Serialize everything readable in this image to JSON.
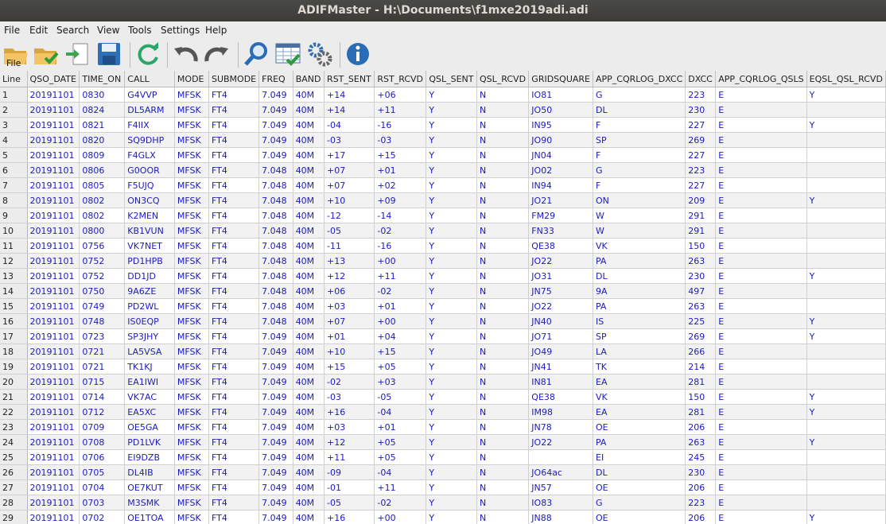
{
  "window": {
    "title": "ADIFMaster - H:\\Documents\\f1mxe2019adi.adi"
  },
  "menu": [
    "File",
    "Edit",
    "Search",
    "View",
    "Tools",
    "Settings",
    "Help"
  ],
  "toolbar": {
    "file_label": "File"
  },
  "table": {
    "columns": [
      "Line",
      "QSO_DATE",
      "TIME_ON",
      "CALL",
      "MODE",
      "SUBMODE",
      "FREQ",
      "BAND",
      "RST_SENT",
      "RST_RCVD",
      "QSL_SENT",
      "QSL_RCVD",
      "GRIDSQUARE",
      "APP_CQRLOG_DXCC",
      "DXCC",
      "APP_CQRLOG_QSLS",
      "EQSL_QSL_RCVD"
    ],
    "rows": [
      [
        "1",
        "20191101",
        "0830",
        "G4VVP",
        "MFSK",
        "FT4",
        "7.049",
        "40M",
        "+14",
        "+06",
        "Y",
        "N",
        "IO81",
        "G",
        "223",
        "E",
        "Y"
      ],
      [
        "2",
        "20191101",
        "0824",
        "DL5ARM",
        "MFSK",
        "FT4",
        "7.049",
        "40M",
        "+14",
        "+11",
        "Y",
        "N",
        "JO50",
        "DL",
        "230",
        "E",
        ""
      ],
      [
        "3",
        "20191101",
        "0821",
        "F4IIX",
        "MFSK",
        "FT4",
        "7.049",
        "40M",
        "-04",
        "-16",
        "Y",
        "N",
        "IN95",
        "F",
        "227",
        "E",
        "Y"
      ],
      [
        "4",
        "20191101",
        "0820",
        "SQ9DHP",
        "MFSK",
        "FT4",
        "7.049",
        "40M",
        "-03",
        "-03",
        "Y",
        "N",
        "JO90",
        "SP",
        "269",
        "E",
        ""
      ],
      [
        "5",
        "20191101",
        "0809",
        "F4GLX",
        "MFSK",
        "FT4",
        "7.049",
        "40M",
        "+17",
        "+15",
        "Y",
        "N",
        "JN04",
        "F",
        "227",
        "E",
        ""
      ],
      [
        "6",
        "20191101",
        "0806",
        "G0OOR",
        "MFSK",
        "FT4",
        "7.048",
        "40M",
        "+07",
        "+01",
        "Y",
        "N",
        "JO02",
        "G",
        "223",
        "E",
        ""
      ],
      [
        "7",
        "20191101",
        "0805",
        "F5UJQ",
        "MFSK",
        "FT4",
        "7.048",
        "40M",
        "+07",
        "+02",
        "Y",
        "N",
        "IN94",
        "F",
        "227",
        "E",
        ""
      ],
      [
        "8",
        "20191101",
        "0802",
        "ON3CQ",
        "MFSK",
        "FT4",
        "7.048",
        "40M",
        "+10",
        "+09",
        "Y",
        "N",
        "JO21",
        "ON",
        "209",
        "E",
        "Y"
      ],
      [
        "9",
        "20191101",
        "0802",
        "K2MEN",
        "MFSK",
        "FT4",
        "7.048",
        "40M",
        "-12",
        "-14",
        "Y",
        "N",
        "FM29",
        "W",
        "291",
        "E",
        ""
      ],
      [
        "10",
        "20191101",
        "0800",
        "KB1VUN",
        "MFSK",
        "FT4",
        "7.048",
        "40M",
        "-05",
        "-02",
        "Y",
        "N",
        "FN33",
        "W",
        "291",
        "E",
        ""
      ],
      [
        "11",
        "20191101",
        "0756",
        "VK7NET",
        "MFSK",
        "FT4",
        "7.048",
        "40M",
        "-11",
        "-16",
        "Y",
        "N",
        "QE38",
        "VK",
        "150",
        "E",
        ""
      ],
      [
        "12",
        "20191101",
        "0752",
        "PD1HPB",
        "MFSK",
        "FT4",
        "7.048",
        "40M",
        "+13",
        "+00",
        "Y",
        "N",
        "JO22",
        "PA",
        "263",
        "E",
        ""
      ],
      [
        "13",
        "20191101",
        "0752",
        "DD1JD",
        "MFSK",
        "FT4",
        "7.048",
        "40M",
        "+12",
        "+11",
        "Y",
        "N",
        "JO31",
        "DL",
        "230",
        "E",
        "Y"
      ],
      [
        "14",
        "20191101",
        "0750",
        "9A6ZE",
        "MFSK",
        "FT4",
        "7.048",
        "40M",
        "+06",
        "-02",
        "Y",
        "N",
        "JN75",
        "9A",
        "497",
        "E",
        ""
      ],
      [
        "15",
        "20191101",
        "0749",
        "PD2WL",
        "MFSK",
        "FT4",
        "7.048",
        "40M",
        "+03",
        "+01",
        "Y",
        "N",
        "JO22",
        "PA",
        "263",
        "E",
        ""
      ],
      [
        "16",
        "20191101",
        "0748",
        "IS0EQP",
        "MFSK",
        "FT4",
        "7.048",
        "40M",
        "+07",
        "+00",
        "Y",
        "N",
        "JN40",
        "IS",
        "225",
        "E",
        "Y"
      ],
      [
        "17",
        "20191101",
        "0723",
        "SP3JHY",
        "MFSK",
        "FT4",
        "7.049",
        "40M",
        "+01",
        "+04",
        "Y",
        "N",
        "JO71",
        "SP",
        "269",
        "E",
        "Y"
      ],
      [
        "18",
        "20191101",
        "0721",
        "LA5VSA",
        "MFSK",
        "FT4",
        "7.049",
        "40M",
        "+10",
        "+15",
        "Y",
        "N",
        "JO49",
        "LA",
        "266",
        "E",
        ""
      ],
      [
        "19",
        "20191101",
        "0721",
        "TK1KJ",
        "MFSK",
        "FT4",
        "7.049",
        "40M",
        "+15",
        "+05",
        "Y",
        "N",
        "JN41",
        "TK",
        "214",
        "E",
        ""
      ],
      [
        "20",
        "20191101",
        "0715",
        "EA1IWI",
        "MFSK",
        "FT4",
        "7.049",
        "40M",
        "-02",
        "+03",
        "Y",
        "N",
        "IN81",
        "EA",
        "281",
        "E",
        ""
      ],
      [
        "21",
        "20191101",
        "0714",
        "VK7AC",
        "MFSK",
        "FT4",
        "7.049",
        "40M",
        "-03",
        "-05",
        "Y",
        "N",
        "QE38",
        "VK",
        "150",
        "E",
        "Y"
      ],
      [
        "22",
        "20191101",
        "0712",
        "EA5XC",
        "MFSK",
        "FT4",
        "7.049",
        "40M",
        "+16",
        "-04",
        "Y",
        "N",
        "IM98",
        "EA",
        "281",
        "E",
        "Y"
      ],
      [
        "23",
        "20191101",
        "0709",
        "OE5GA",
        "MFSK",
        "FT4",
        "7.049",
        "40M",
        "+03",
        "+01",
        "Y",
        "N",
        "JN78",
        "OE",
        "206",
        "E",
        ""
      ],
      [
        "24",
        "20191101",
        "0708",
        "PD1LVK",
        "MFSK",
        "FT4",
        "7.049",
        "40M",
        "+12",
        "+05",
        "Y",
        "N",
        "JO22",
        "PA",
        "263",
        "E",
        "Y"
      ],
      [
        "25",
        "20191101",
        "0706",
        "EI9DZB",
        "MFSK",
        "FT4",
        "7.049",
        "40M",
        "+11",
        "+05",
        "Y",
        "N",
        "",
        "EI",
        "245",
        "E",
        ""
      ],
      [
        "26",
        "20191101",
        "0705",
        "DL4IB",
        "MFSK",
        "FT4",
        "7.049",
        "40M",
        "-09",
        "-04",
        "Y",
        "N",
        "JO64ac",
        "DL",
        "230",
        "E",
        ""
      ],
      [
        "27",
        "20191101",
        "0704",
        "OE7KUT",
        "MFSK",
        "FT4",
        "7.049",
        "40M",
        "-01",
        "+11",
        "Y",
        "N",
        "JN57",
        "OE",
        "206",
        "E",
        ""
      ],
      [
        "28",
        "20191101",
        "0703",
        "M3SMK",
        "MFSK",
        "FT4",
        "7.049",
        "40M",
        "-05",
        "-02",
        "Y",
        "N",
        "IO83",
        "G",
        "223",
        "E",
        ""
      ],
      [
        "29",
        "20191101",
        "0702",
        "OE1TOA",
        "MFSK",
        "FT4",
        "7.049",
        "40M",
        "+16",
        "+00",
        "Y",
        "N",
        "JN88",
        "OE",
        "206",
        "E",
        "Y"
      ]
    ]
  },
  "colors": {
    "cell_text": "#1b1bbf",
    "title_bg": "#3c3b37"
  },
  "icons": [
    "folder-open-icon",
    "folder-check-icon",
    "import-icon",
    "save-icon",
    "refresh-icon",
    "undo-icon",
    "redo-icon",
    "search-icon",
    "spreadsheet-check-icon",
    "settings-gears-icon",
    "info-icon"
  ]
}
